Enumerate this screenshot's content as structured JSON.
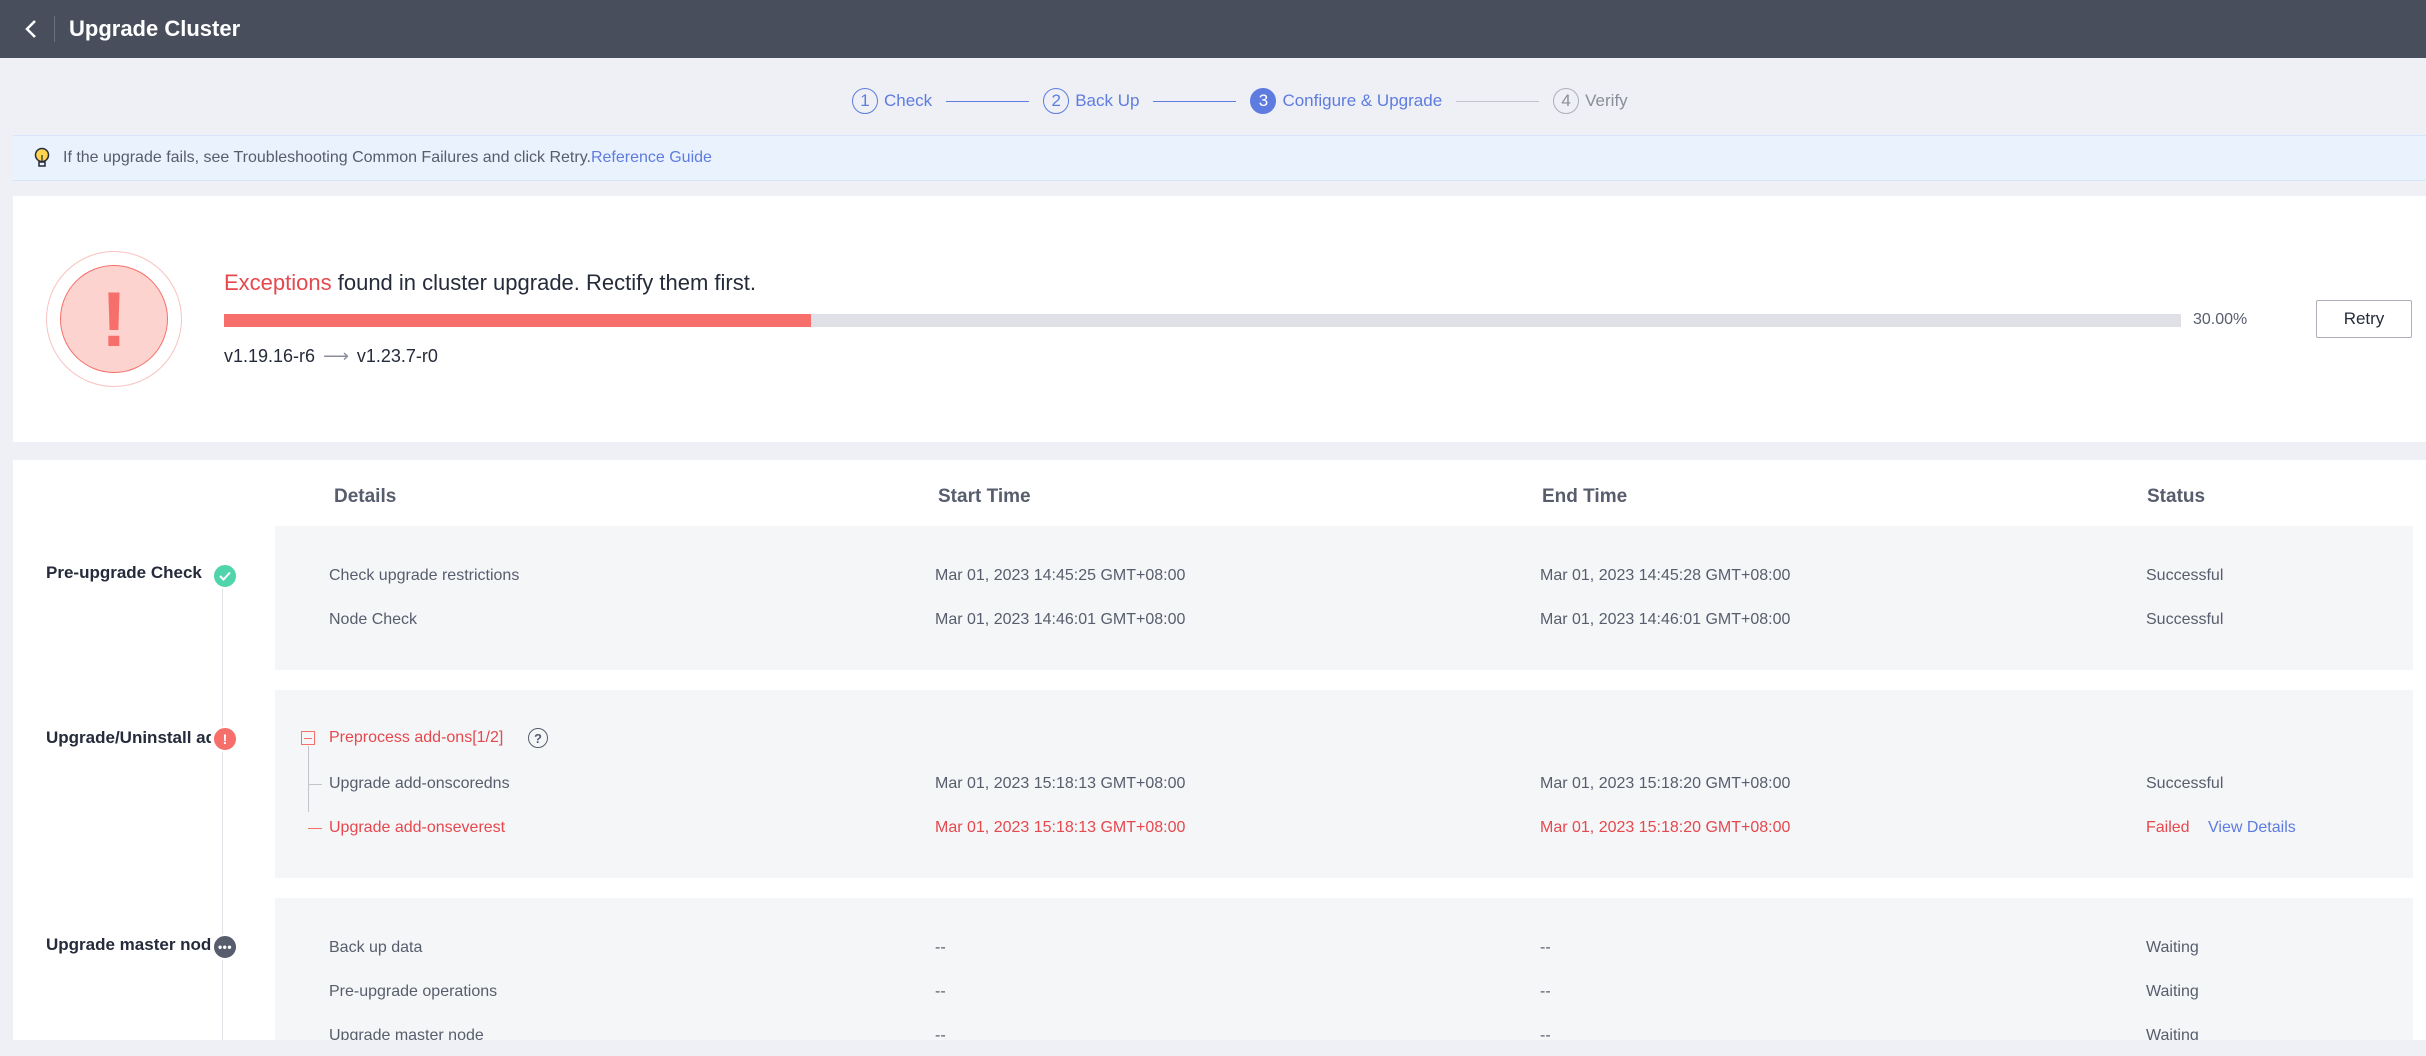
{
  "header": {
    "title": "Upgrade Cluster",
    "back_icon": "chevron-left-icon"
  },
  "steps": [
    {
      "num": "1",
      "label": "Check",
      "state": "done"
    },
    {
      "num": "2",
      "label": "Back Up",
      "state": "done"
    },
    {
      "num": "3",
      "label": "Configure & Upgrade",
      "state": "active"
    },
    {
      "num": "4",
      "label": "Verify",
      "state": "pending"
    }
  ],
  "notice": {
    "icon": "lightbulb-icon",
    "text": "If the upgrade fails, see Troubleshooting Common Failures and click Retry.",
    "link": "Reference Guide"
  },
  "status": {
    "exceptions_word": "Exceptions",
    "message_rest": " found in cluster upgrade. Rectify them first.",
    "progress_percent": 30.0,
    "progress_label": "30.00%",
    "from_version": "v1.19.16-r6",
    "arrow": "⟶",
    "to_version": "v1.23.7-r0",
    "retry_label": "Retry",
    "alert_glyph": "!"
  },
  "table": {
    "headers": {
      "details": "Details",
      "start": "Start Time",
      "end": "End Time",
      "status": "Status"
    },
    "groups": [
      {
        "label": "Pre-upgrade Check",
        "state": "success",
        "rows": [
          {
            "detail": "Check upgrade restrictions",
            "start": "Mar 01, 2023 14:45:25 GMT+08:00",
            "end": "Mar 01, 2023 14:45:28 GMT+08:00",
            "status": "Successful"
          },
          {
            "detail": "Node Check",
            "start": "Mar 01, 2023 14:46:01 GMT+08:00",
            "end": "Mar 01, 2023 14:46:01 GMT+08:00",
            "status": "Successful"
          }
        ]
      },
      {
        "label": "Upgrade/Uninstall add-ons",
        "state": "error",
        "subgroup": "Preprocess add-ons[1/2]",
        "rows": [
          {
            "detail": "Upgrade add-onscoredns",
            "start": "Mar 01, 2023 15:18:13 GMT+08:00",
            "end": "Mar 01, 2023 15:18:20 GMT+08:00",
            "status": "Successful"
          },
          {
            "detail": "Upgrade add-onseverest",
            "start": "Mar 01, 2023 15:18:13 GMT+08:00",
            "end": "Mar 01, 2023 15:18:20 GMT+08:00",
            "status": "Failed",
            "action": "View Details"
          }
        ]
      },
      {
        "label": "Upgrade master node",
        "state": "waiting",
        "rows": [
          {
            "detail": "Back up data",
            "start": "--",
            "end": "--",
            "status": "Waiting"
          },
          {
            "detail": "Pre-upgrade operations",
            "start": "--",
            "end": "--",
            "status": "Waiting"
          },
          {
            "detail": "Upgrade master node",
            "start": "--",
            "end": "--",
            "status": "Waiting"
          }
        ]
      }
    ]
  },
  "colors": {
    "accent": "#5e7ce0",
    "error": "#e5484d",
    "success": "#50d4ab",
    "header_bg": "#484e5c"
  }
}
